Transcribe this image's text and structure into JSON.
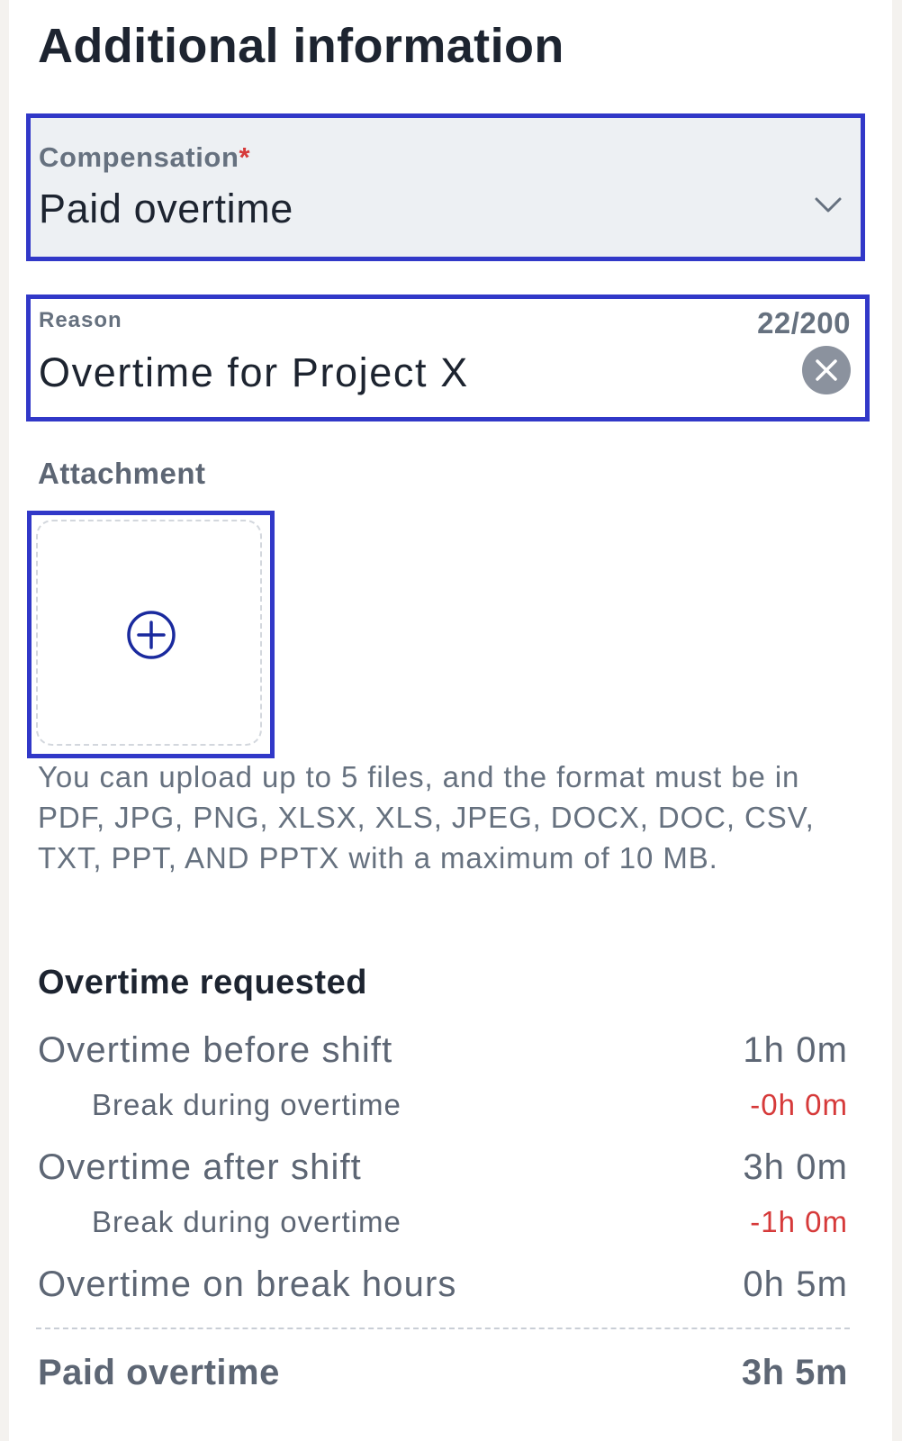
{
  "section": {
    "title": "Additional information"
  },
  "compensation": {
    "label": "Compensation",
    "required_mark": "*",
    "value": "Paid overtime"
  },
  "reason": {
    "label": "Reason",
    "counter": "22/200",
    "value": "Overtime for Project X"
  },
  "attachment": {
    "label": "Attachment",
    "help_text": "You can upload up to 5 files, and the format must be in PDF, JPG, PNG, XLSX, XLS, JPEG, DOCX, DOC, CSV, TXT, PPT, AND PPTX with a maximum of 10 MB."
  },
  "overtime": {
    "title": "Overtime requested",
    "rows": [
      {
        "label": "Overtime before shift",
        "value": "1h 0m"
      },
      {
        "label": "Break during overtime",
        "value": "-0h 0m"
      },
      {
        "label": "Overtime after shift",
        "value": "3h 0m"
      },
      {
        "label": "Break during overtime",
        "value": "-1h 0m"
      },
      {
        "label": "Overtime on break hours",
        "value": "0h 5m"
      }
    ],
    "total": {
      "label": "Paid overtime",
      "value": "3h 5m"
    }
  },
  "colors": {
    "focus_border": "#3138c8",
    "negative": "#d63a3a",
    "muted_text": "#66717f",
    "heading_text": "#1d2430"
  },
  "icons": {
    "compensation_dropdown": "chevron-down-icon",
    "reason_clear": "close-circle-icon",
    "attachment_add": "plus-circle-icon"
  }
}
